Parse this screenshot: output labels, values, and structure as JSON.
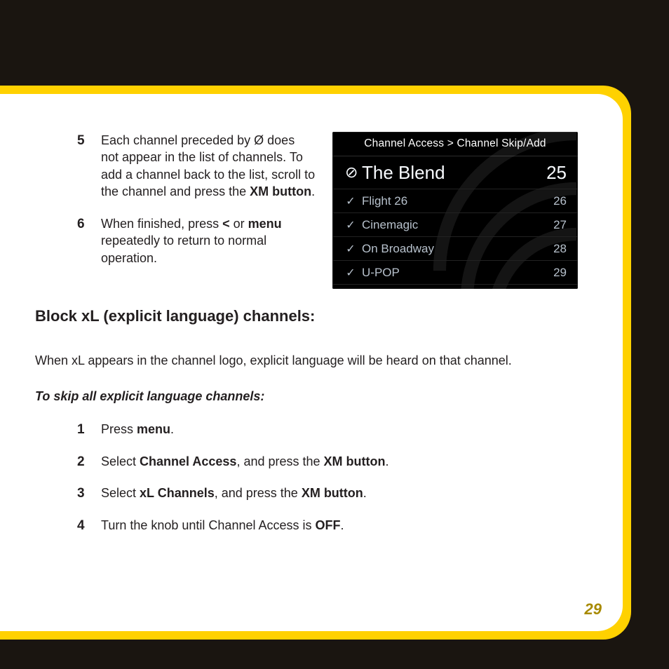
{
  "page_number": "29",
  "top_steps": [
    {
      "num": "5",
      "runs": [
        {
          "t": "Each channel preceded by Ø does not appear in the list of channels. To add a channel back to the list, scroll to the channel and press the "
        },
        {
          "t": "XM button",
          "b": true
        },
        {
          "t": "."
        }
      ]
    },
    {
      "num": "6",
      "runs": [
        {
          "t": "When finished, press "
        },
        {
          "t": "<",
          "b": true
        },
        {
          "t": " or "
        },
        {
          "t": "menu",
          "b": true
        },
        {
          "t": " repeatedly to return to normal operation."
        }
      ]
    }
  ],
  "screen": {
    "header": "Channel Access > Channel Skip/Add",
    "rows": [
      {
        "mark": "⊘",
        "name": "The Blend",
        "num": "25",
        "sel": true
      },
      {
        "mark": "✓",
        "name": "Flight 26",
        "num": "26"
      },
      {
        "mark": "✓",
        "name": "Cinemagic",
        "num": "27"
      },
      {
        "mark": "✓",
        "name": "On Broadway",
        "num": "28"
      },
      {
        "mark": "✓",
        "name": "U-POP",
        "num": "29"
      }
    ]
  },
  "heading": "Block xL (explicit language) channels:",
  "intro": "When xL appears in the channel logo, explicit language will be heard on that channel.",
  "subheading": "To skip all explicit language channels:",
  "bottom_steps": [
    {
      "num": "1",
      "runs": [
        {
          "t": "Press "
        },
        {
          "t": "menu",
          "b": true
        },
        {
          "t": "."
        }
      ]
    },
    {
      "num": "2",
      "runs": [
        {
          "t": "Select "
        },
        {
          "t": "Channel Access",
          "b": true
        },
        {
          "t": ", and press the "
        },
        {
          "t": "XM button",
          "b": true
        },
        {
          "t": "."
        }
      ]
    },
    {
      "num": "3",
      "runs": [
        {
          "t": "Select "
        },
        {
          "t": "xL Channels",
          "b": true
        },
        {
          "t": ", and press the "
        },
        {
          "t": "XM button",
          "b": true
        },
        {
          "t": "."
        }
      ]
    },
    {
      "num": "4",
      "runs": [
        {
          "t": " Turn the knob until Channel Access is "
        },
        {
          "t": "OFF",
          "b": true
        },
        {
          "t": "."
        }
      ]
    }
  ]
}
